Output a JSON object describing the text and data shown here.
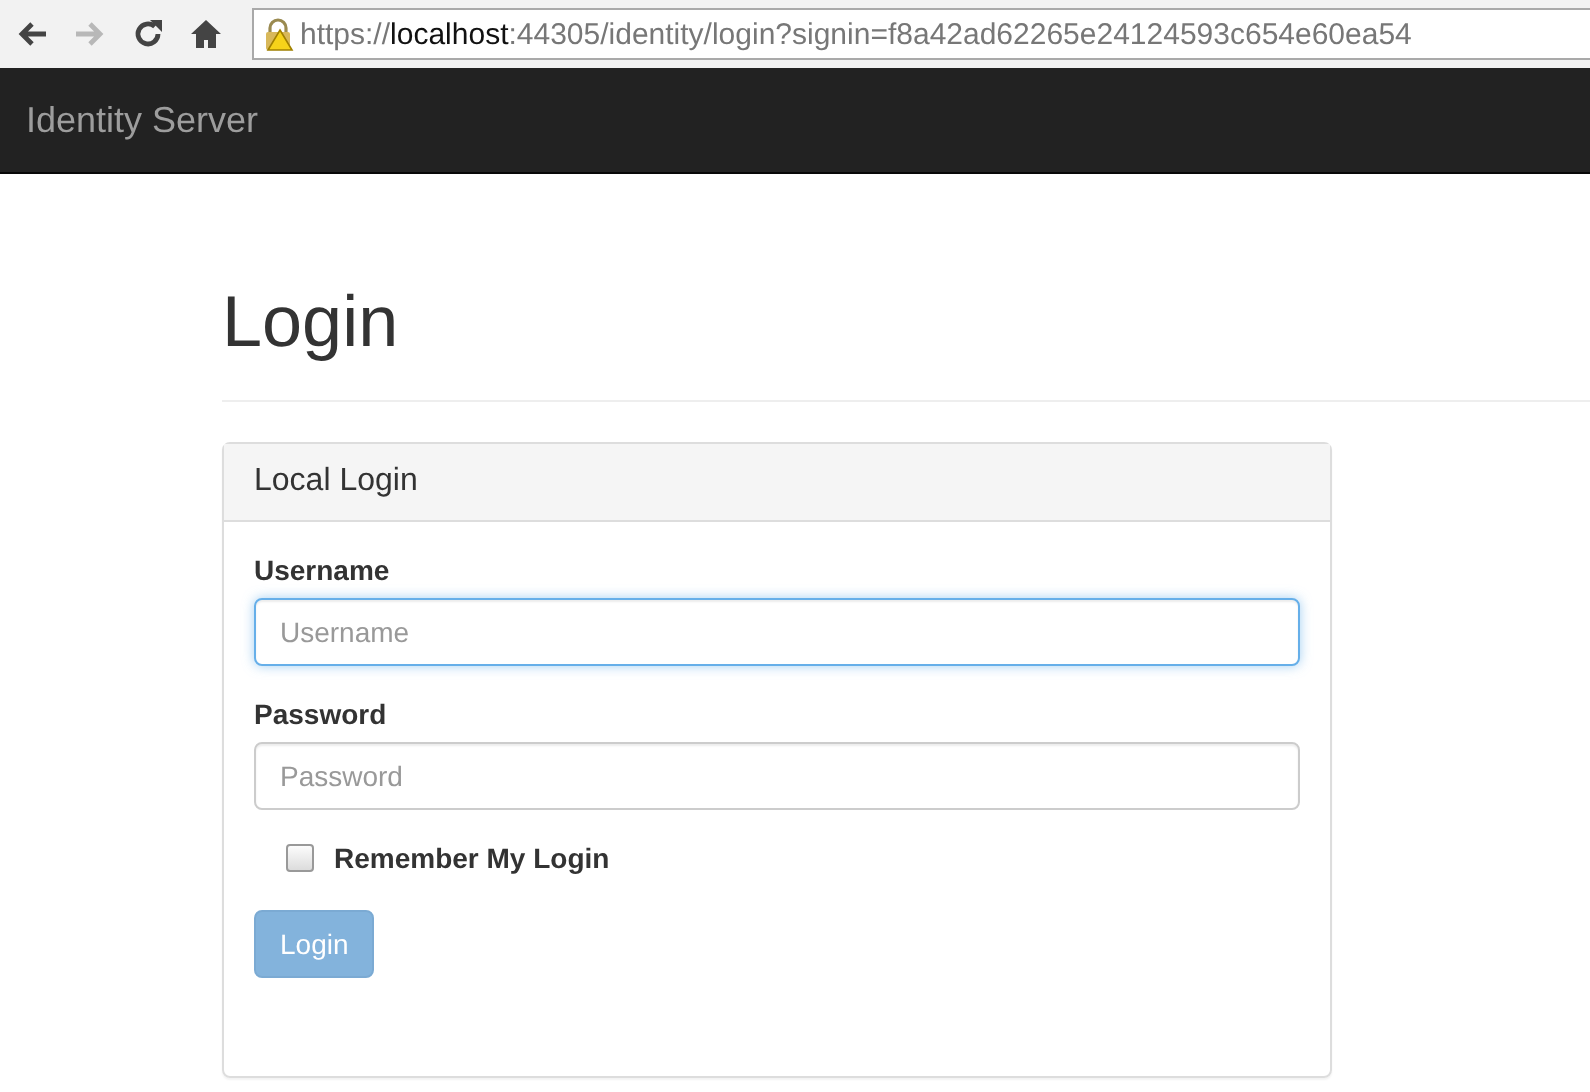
{
  "browser": {
    "url": {
      "scheme": "https://",
      "host": "localhost",
      "rest": ":44305/identity/login?signin=f8a42ad62265e24124593c654e60ea54"
    },
    "forward_disabled": true
  },
  "navbar": {
    "brand": "Identity Server"
  },
  "page": {
    "heading": "Login"
  },
  "panel": {
    "title": "Local Login",
    "fields": [
      {
        "label": "Username",
        "placeholder": "Username",
        "focused": true
      },
      {
        "label": "Password",
        "placeholder": "Password",
        "focused": false
      }
    ],
    "remember": {
      "label": "Remember My Login",
      "checked": false
    },
    "button": {
      "label": "Login",
      "disabled": true
    }
  }
}
